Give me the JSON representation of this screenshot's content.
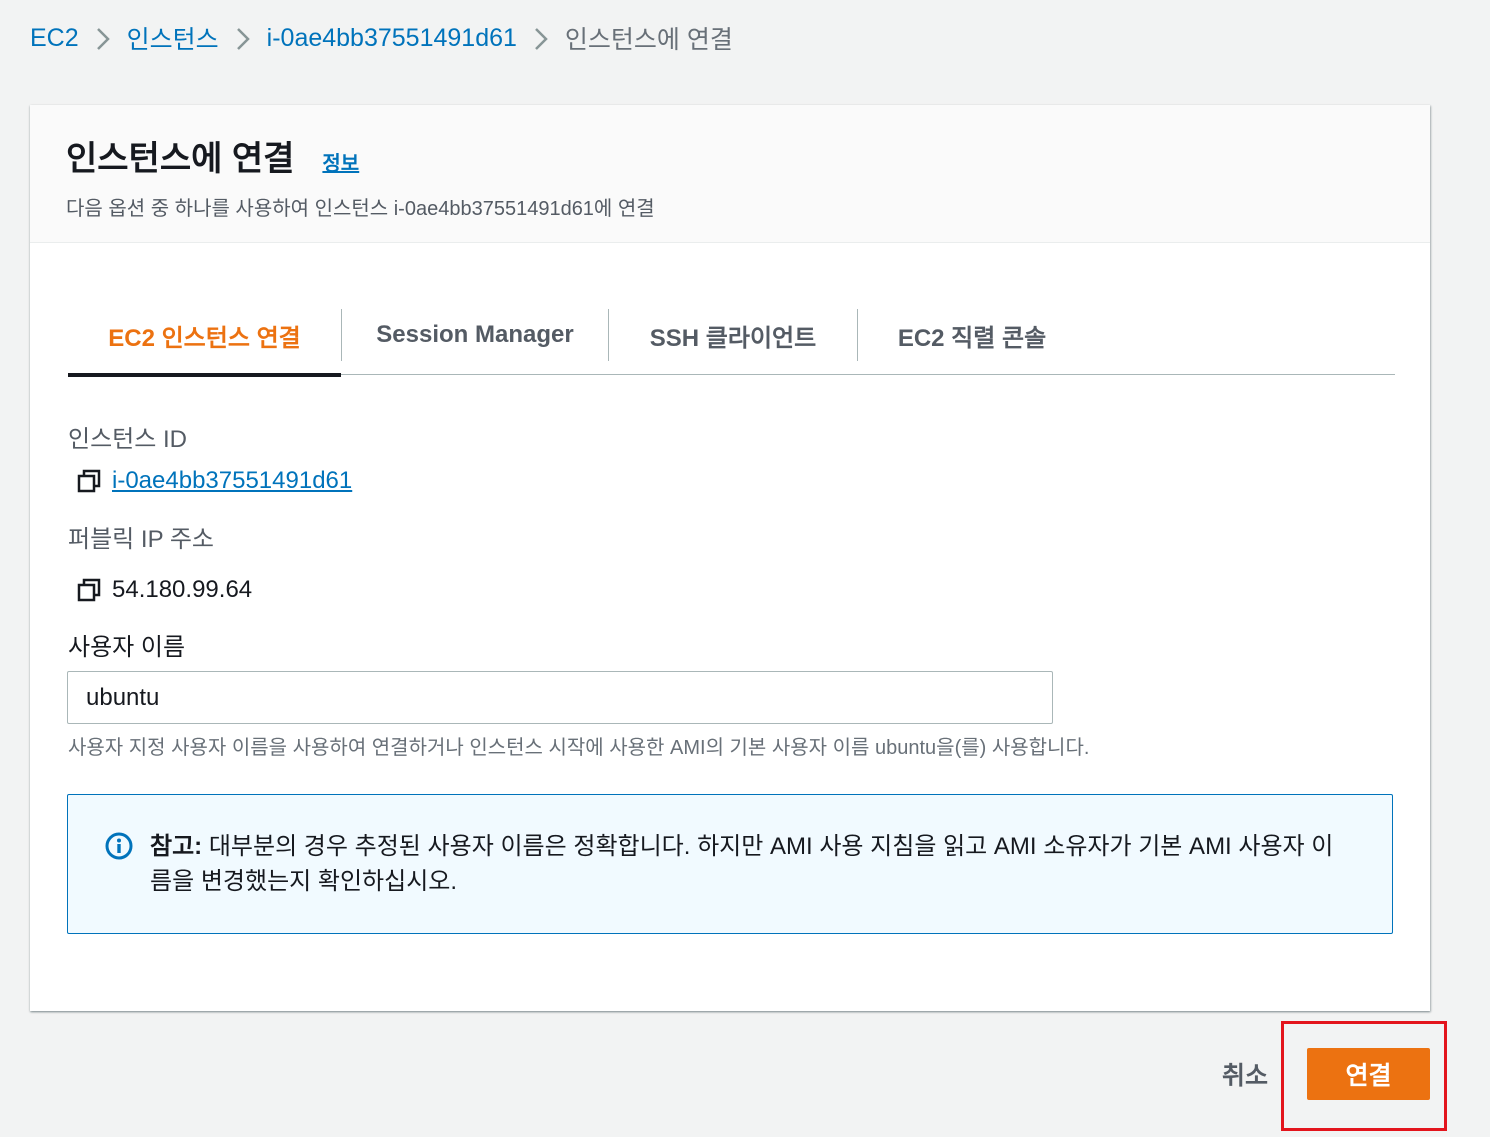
{
  "breadcrumb": {
    "items": [
      "EC2",
      "인스턴스",
      "i-0ae4bb37551491d61"
    ],
    "current": "인스턴스에 연결"
  },
  "header": {
    "title": "인스턴스에 연결",
    "info_label": "정보",
    "description": "다음 옵션 중 하나를 사용하여 인스턴스 i-0ae4bb37551491d61에 연결"
  },
  "tabs": [
    {
      "label": "EC2 인스턴스 연결",
      "active": true
    },
    {
      "label": "Session Manager",
      "active": false
    },
    {
      "label": "SSH 클라이언트",
      "active": false
    },
    {
      "label": "EC2 직렬 콘솔",
      "active": false
    }
  ],
  "instance": {
    "id_label": "인스턴스 ID",
    "id_value": "i-0ae4bb37551491d61",
    "ip_label": "퍼블릭 IP 주소",
    "ip_value": "54.180.99.64"
  },
  "username": {
    "label": "사용자 이름",
    "value": "ubuntu",
    "hint": "사용자 지정 사용자 이름을 사용하여 연결하거나 인스턴스 시작에 사용한 AMI의 기본 사용자 이름 ubuntu을(를) 사용합니다."
  },
  "alert": {
    "prefix": "참고:",
    "text": " 대부분의 경우 추정된 사용자 이름은 정확합니다. 하지만 AMI 사용 지침을 읽고 AMI 소유자가 기본 AMI 사용자 이름을 변경했는지 확인하십시오."
  },
  "actions": {
    "cancel_label": "취소",
    "connect_label": "연결"
  },
  "colors": {
    "link": "#0073bb",
    "accent": "#ec7211",
    "highlight": "#e3141c"
  }
}
